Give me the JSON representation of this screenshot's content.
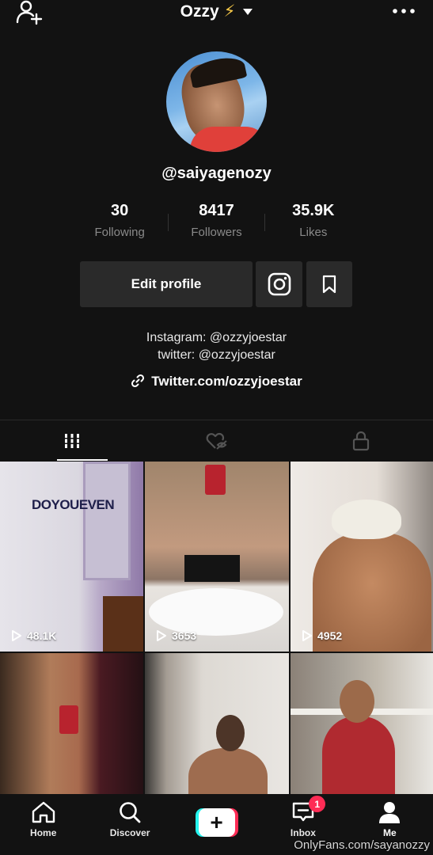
{
  "header": {
    "title": "Ozzy",
    "title_emoji": "⚡"
  },
  "profile": {
    "username": "@saiyagenozy",
    "stats": [
      {
        "value": "30",
        "label": "Following"
      },
      {
        "value": "8417",
        "label": "Followers"
      },
      {
        "value": "35.9K",
        "label": "Likes"
      }
    ],
    "edit_profile_label": "Edit profile",
    "bio_lines": [
      "Instagram: @ozzyjoestar",
      "twitter: @ozzyjoestar"
    ],
    "link": "Twitter.com/ozzyjoestar"
  },
  "tabs": [
    {
      "icon": "grid-icon",
      "active": true
    },
    {
      "icon": "liked-hidden-icon",
      "active": false
    },
    {
      "icon": "lock-icon",
      "active": false
    }
  ],
  "videos": [
    {
      "views": "48.1K",
      "overlay_text": "DOYOUEVEN"
    },
    {
      "views": "3653"
    },
    {
      "views": "4952"
    },
    {
      "views": ""
    },
    {
      "views": ""
    },
    {
      "views": ""
    }
  ],
  "bottom_nav": {
    "home": "Home",
    "discover": "Discover",
    "inbox": "Inbox",
    "inbox_badge": "1",
    "me": "Me"
  },
  "watermark": "OnlyFans.com/sayanozzy",
  "colors": {
    "accent_cyan": "#25f4ee",
    "accent_red": "#fe2c55",
    "background": "#121212"
  }
}
